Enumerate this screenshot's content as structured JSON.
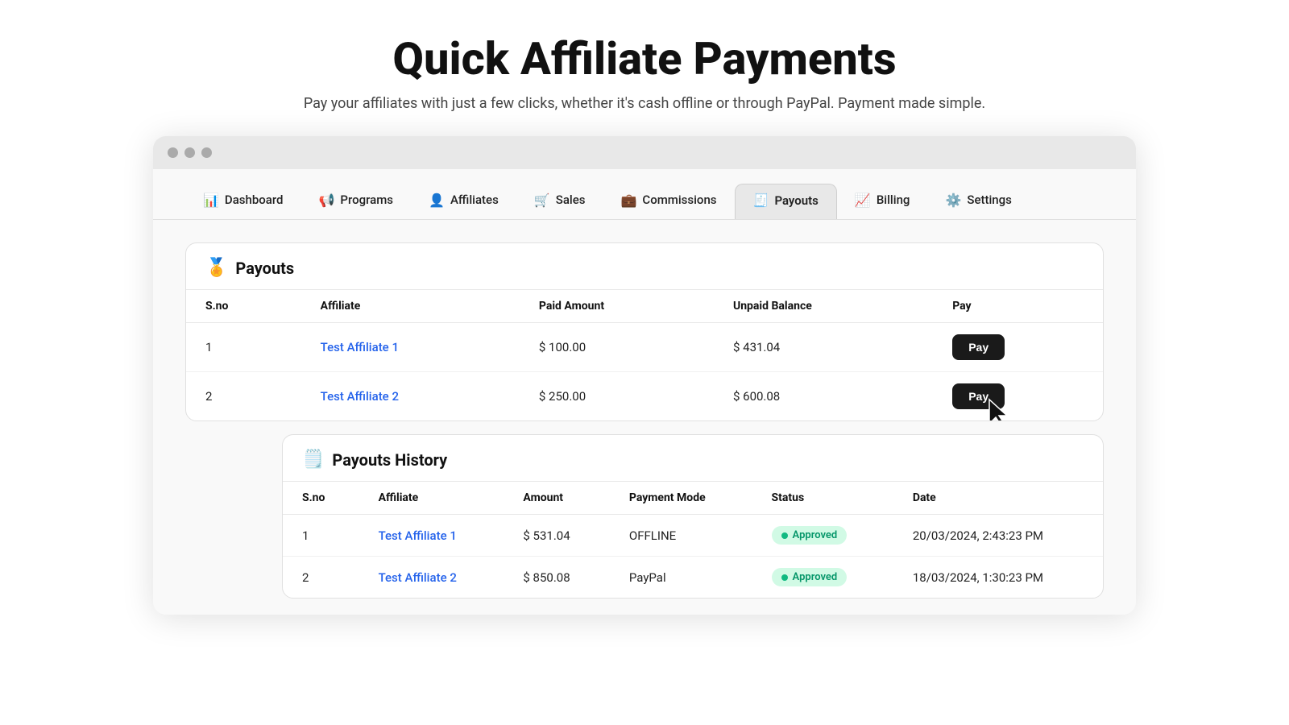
{
  "page": {
    "title": "Quick Affiliate Payments",
    "subtitle": "Pay your affiliates with just a few clicks, whether it's cash offline or through PayPal. Payment made simple."
  },
  "nav": {
    "items": [
      {
        "id": "dashboard",
        "label": "Dashboard",
        "icon": "📊",
        "active": false
      },
      {
        "id": "programs",
        "label": "Programs",
        "icon": "📢",
        "active": false
      },
      {
        "id": "affiliates",
        "label": "Affiliates",
        "icon": "👤",
        "active": false
      },
      {
        "id": "sales",
        "label": "Sales",
        "icon": "🛒",
        "active": false
      },
      {
        "id": "commissions",
        "label": "Commissions",
        "icon": "💼",
        "active": false
      },
      {
        "id": "payouts",
        "label": "Payouts",
        "icon": "🧾",
        "active": true
      },
      {
        "id": "billing",
        "label": "Billing",
        "icon": "📈",
        "active": false
      },
      {
        "id": "settings",
        "label": "Settings",
        "icon": "⚙️",
        "active": false
      }
    ]
  },
  "payouts_section": {
    "title": "Payouts",
    "icon": "🏅",
    "columns": [
      "S.no",
      "Affiliate",
      "Paid Amount",
      "Unpaid Balance",
      "Pay"
    ],
    "rows": [
      {
        "sno": "1",
        "affiliate": "Test Affiliate 1",
        "paid": "$ 100.00",
        "unpaid": "$ 431.04",
        "pay_label": "Pay"
      },
      {
        "sno": "2",
        "affiliate": "Test Affiliate 2",
        "paid": "$ 250.00",
        "unpaid": "$ 600.08",
        "pay_label": "Pay"
      }
    ]
  },
  "history_section": {
    "title": "Payouts History",
    "icon": "🗒️",
    "columns": [
      "S.no",
      "Affiliate",
      "Amount",
      "Payment Mode",
      "Status",
      "Date"
    ],
    "rows": [
      {
        "sno": "1",
        "affiliate": "Test Affiliate 1",
        "amount": "$ 531.04",
        "mode": "OFFLINE",
        "status": "Approved",
        "date": "20/03/2024, 2:43:23 PM"
      },
      {
        "sno": "2",
        "affiliate": "Test Affiliate 2",
        "amount": "$ 850.08",
        "mode": "PayPal",
        "status": "Approved",
        "date": "18/03/2024, 1:30:23 PM"
      }
    ]
  }
}
